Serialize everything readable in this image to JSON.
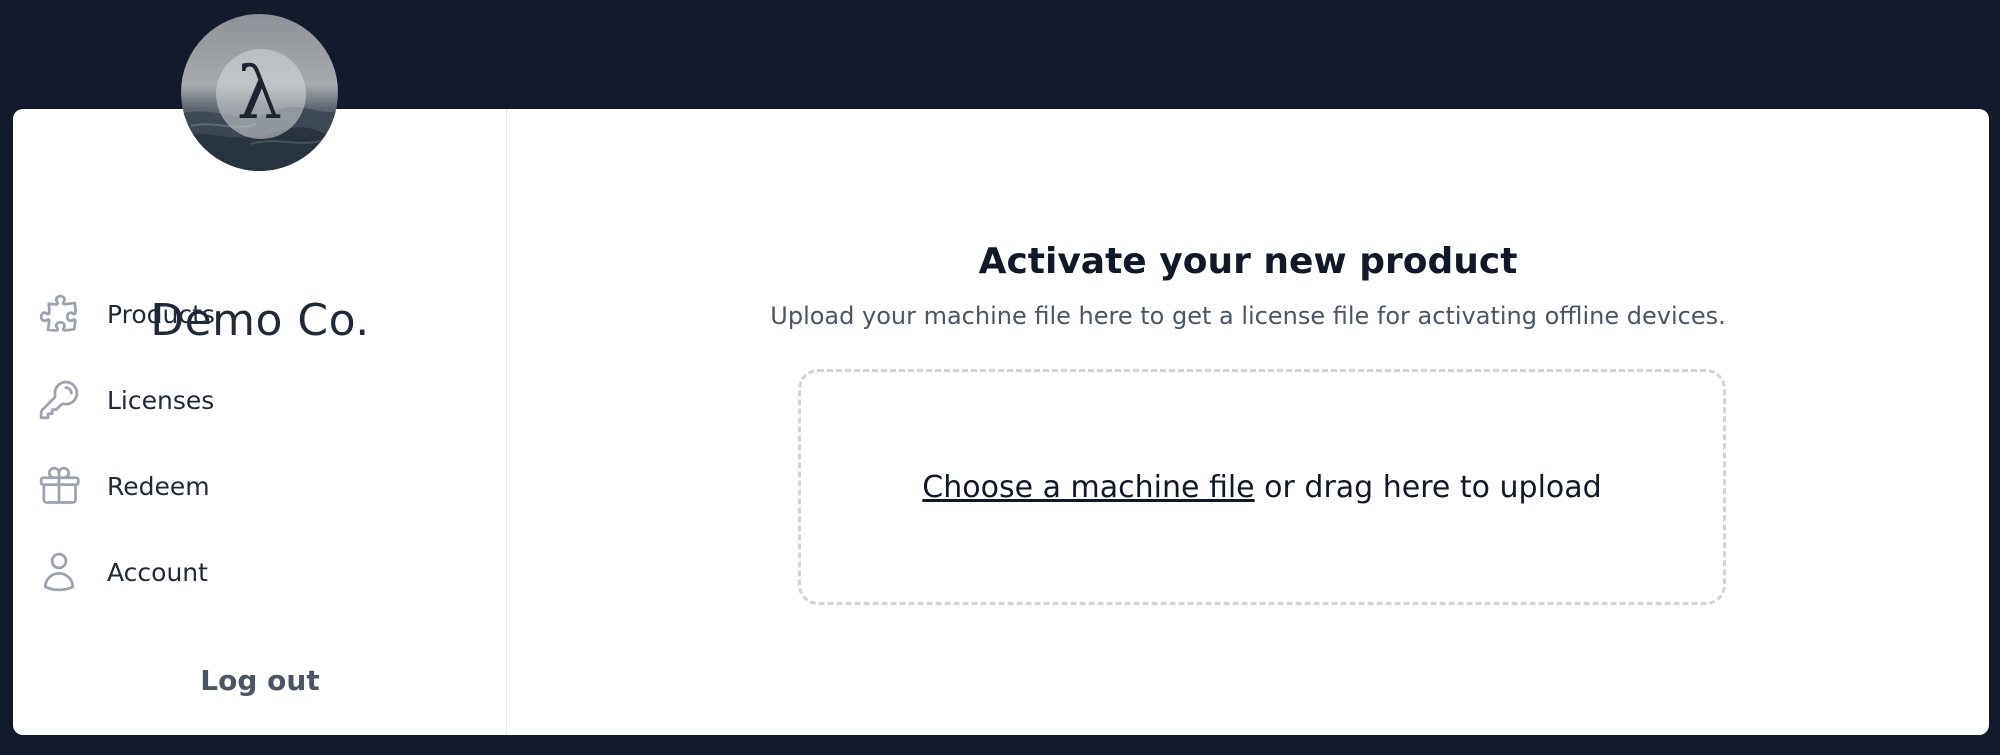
{
  "sidebar": {
    "org_name": "Demo Co.",
    "avatar_glyph": "λ",
    "items": [
      {
        "label": "Products",
        "icon": "puzzle-icon"
      },
      {
        "label": "Licenses",
        "icon": "key-icon"
      },
      {
        "label": "Redeem",
        "icon": "gift-icon"
      },
      {
        "label": "Account",
        "icon": "user-icon"
      }
    ],
    "logout_label": "Log out"
  },
  "main": {
    "title": "Activate your new product",
    "subtitle": "Upload your machine file here to get a license file for activating offline devices.",
    "dropzone": {
      "link_label": "Choose a machine file",
      "rest_label": " or drag here to upload"
    }
  },
  "colors": {
    "background": "#121a2b",
    "card": "#ffffff",
    "icon": "#9ca3af",
    "text": "#1f2937",
    "dropzone_border": "#d1d5db"
  }
}
